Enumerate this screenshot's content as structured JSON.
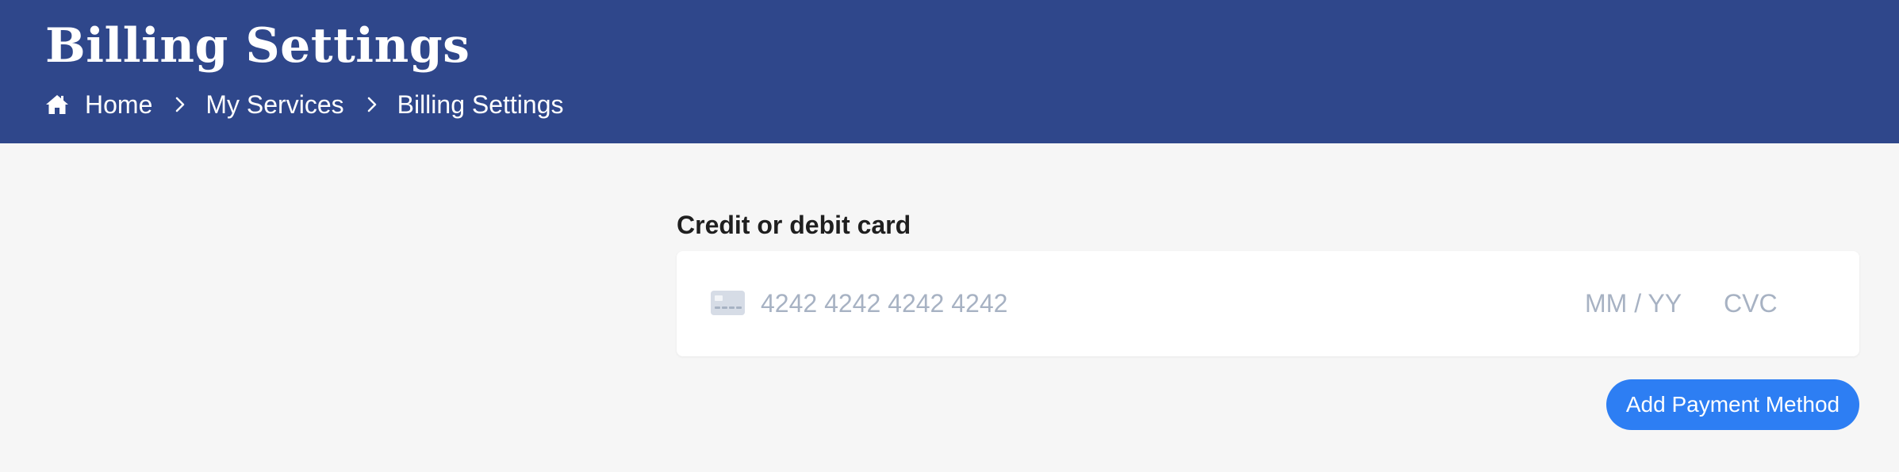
{
  "header": {
    "title": "Billing Settings",
    "breadcrumb": [
      {
        "label": "Home"
      },
      {
        "label": "My Services"
      },
      {
        "label": "Billing Settings"
      }
    ]
  },
  "card_form": {
    "label": "Credit or debit card",
    "number_placeholder": "4242 4242 4242 4242",
    "expiry_placeholder": "MM / YY",
    "cvc_placeholder": "CVC"
  },
  "actions": {
    "add_payment_label": "Add Payment Method"
  },
  "colors": {
    "header_bg": "#2f478b",
    "page_bg": "#f6f6f6",
    "button_bg": "#2d7ef3",
    "placeholder": "#a7b2c3"
  },
  "icons": {
    "home": "home-icon",
    "separator": "chevron-right-icon",
    "card": "credit-card-icon"
  }
}
